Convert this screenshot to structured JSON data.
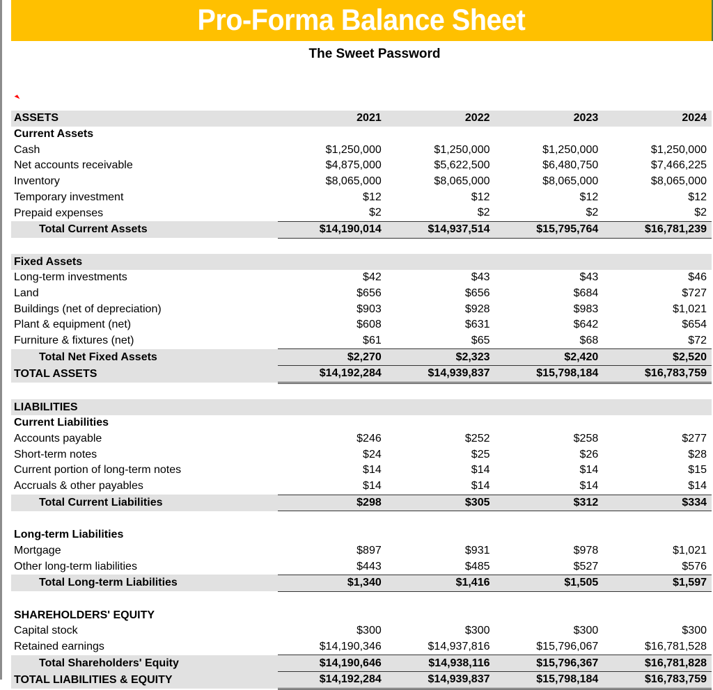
{
  "header": {
    "title": "Pro-Forma Balance Sheet",
    "company": "The Sweet Password",
    "colors": {
      "banner": "#ffc000",
      "title_text": "#ffffff",
      "shade": "#e1e1e1"
    }
  },
  "years": [
    "2021",
    "2022",
    "2023",
    "2024"
  ],
  "assets": {
    "heading": "ASSETS",
    "current": {
      "heading": "Current Assets",
      "rows": [
        {
          "label": "Cash",
          "values": [
            "$1,250,000",
            "$1,250,000",
            "$1,250,000",
            "$1,250,000"
          ]
        },
        {
          "label": "Net accounts receivable",
          "values": [
            "$4,875,000",
            "$5,622,500",
            "$6,480,750",
            "$7,466,225"
          ]
        },
        {
          "label": "Inventory",
          "values": [
            "$8,065,000",
            "$8,065,000",
            "$8,065,000",
            "$8,065,000"
          ]
        },
        {
          "label": "Temporary investment",
          "values": [
            "$12",
            "$12",
            "$12",
            "$12"
          ]
        },
        {
          "label": "Prepaid expenses",
          "values": [
            "$2",
            "$2",
            "$2",
            "$2"
          ]
        }
      ],
      "total": {
        "label": "Total Current Assets",
        "values": [
          "$14,190,014",
          "$14,937,514",
          "$15,795,764",
          "$16,781,239"
        ]
      }
    },
    "fixed": {
      "heading": "Fixed Assets",
      "rows": [
        {
          "label": "Long-term investments",
          "values": [
            "$42",
            "$43",
            "$43",
            "$46"
          ]
        },
        {
          "label": "Land",
          "values": [
            "$656",
            "$656",
            "$684",
            "$727"
          ]
        },
        {
          "label": "Buildings (net of depreciation)",
          "values": [
            "$903",
            "$928",
            "$983",
            "$1,021"
          ]
        },
        {
          "label": "Plant & equipment (net)",
          "values": [
            "$608",
            "$631",
            "$642",
            "$654"
          ]
        },
        {
          "label": "Furniture & fixtures (net)",
          "values": [
            "$61",
            "$65",
            "$68",
            "$72"
          ]
        }
      ],
      "total": {
        "label": "Total Net Fixed Assets",
        "values": [
          "$2,270",
          "$2,323",
          "$2,420",
          "$2,520"
        ]
      }
    },
    "grand_total": {
      "label": "TOTAL ASSETS",
      "values": [
        "$14,192,284",
        "$14,939,837",
        "$15,798,184",
        "$16,783,759"
      ]
    }
  },
  "liabilities": {
    "heading": "LIABILITIES",
    "current": {
      "heading": "Current Liabilities",
      "rows": [
        {
          "label": "Accounts payable",
          "values": [
            "$246",
            "$252",
            "$258",
            "$277"
          ]
        },
        {
          "label": "Short-term notes",
          "values": [
            "$24",
            "$25",
            "$26",
            "$28"
          ]
        },
        {
          "label": "Current portion of long-term notes",
          "values": [
            "$14",
            "$14",
            "$14",
            "$15"
          ]
        },
        {
          "label": "Accruals & other payables",
          "values": [
            "$14",
            "$14",
            "$14",
            "$14"
          ]
        }
      ],
      "total": {
        "label": "Total Current Liabilities",
        "values": [
          "$298",
          "$305",
          "$312",
          "$334"
        ]
      }
    },
    "long_term": {
      "heading": "Long-term Liabilities",
      "rows": [
        {
          "label": "Mortgage",
          "values": [
            "$897",
            "$931",
            "$978",
            "$1,021"
          ]
        },
        {
          "label": "Other long-term liabilities",
          "values": [
            "$443",
            "$485",
            "$527",
            "$576"
          ]
        }
      ],
      "total": {
        "label": "Total Long-term Liabilities",
        "values": [
          "$1,340",
          "$1,416",
          "$1,505",
          "$1,597"
        ]
      }
    }
  },
  "equity": {
    "heading": "SHAREHOLDERS' EQUITY",
    "rows": [
      {
        "label": "Capital stock",
        "values": [
          "$300",
          "$300",
          "$300",
          "$300"
        ]
      },
      {
        "label": "Retained earnings",
        "values": [
          "$14,190,346",
          "$14,937,816",
          "$15,796,067",
          "$16,781,528"
        ]
      }
    ],
    "total": {
      "label": "Total Shareholders' Equity",
      "values": [
        "$14,190,646",
        "$14,938,116",
        "$15,796,367",
        "$16,781,828"
      ]
    },
    "grand_total": {
      "label": "TOTAL LIABILITIES & EQUITY",
      "values": [
        "$14,192,284",
        "$14,939,837",
        "$15,798,184",
        "$16,783,759"
      ]
    }
  }
}
